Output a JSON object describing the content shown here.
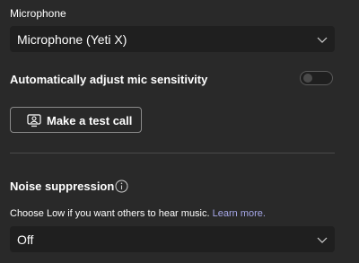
{
  "microphone": {
    "section_label": "Microphone",
    "selected": "Microphone (Yeti X)"
  },
  "auto_adjust": {
    "label": "Automatically adjust mic sensitivity",
    "enabled": false
  },
  "test_call": {
    "label": "Make a test call",
    "icon": "test-call-icon"
  },
  "noise_suppression": {
    "title": "Noise suppression",
    "info_icon": "info-icon",
    "description": "Choose Low if you want others to hear music.",
    "learn_more": "Learn more.",
    "selected": "Off"
  },
  "colors": {
    "background": "#292929",
    "field": "#1f1f1f",
    "link": "#a6a7e8"
  }
}
